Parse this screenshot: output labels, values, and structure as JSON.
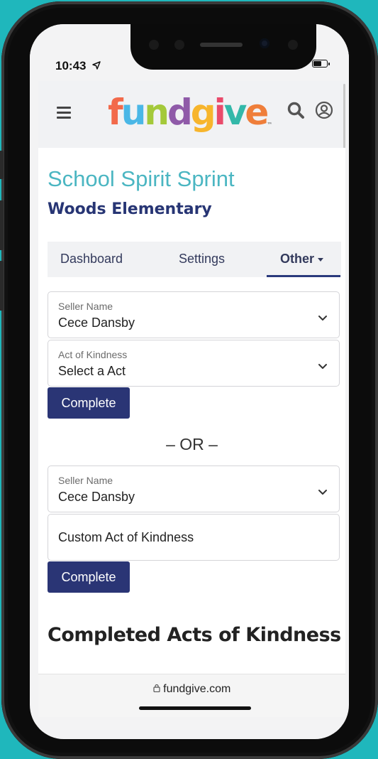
{
  "status_bar": {
    "time": "10:43"
  },
  "app_bar": {
    "logo_text": "fundgive",
    "logo_tm": "™"
  },
  "campaign": {
    "title": "School Spirit Sprint",
    "school": "Woods Elementary"
  },
  "tabs": [
    {
      "label": "Dashboard"
    },
    {
      "label": "Settings"
    },
    {
      "label": "Other",
      "active": true
    }
  ],
  "form1": {
    "seller_label": "Seller Name",
    "seller_value": "Cece Dansby",
    "act_label": "Act of Kindness",
    "act_value": "Select a Act",
    "button": "Complete"
  },
  "separator": "– OR –",
  "form2": {
    "seller_label": "Seller Name",
    "seller_value": "Cece Dansby",
    "custom_placeholder": "Custom Act of Kindness",
    "button": "Complete"
  },
  "section_heading": "Completed Acts of Kindness",
  "browser": {
    "url": "fundgive.com"
  },
  "colors": {
    "accent_teal": "#4bb6c2",
    "navy": "#273574",
    "button": "#2a3575",
    "background": "#1fb7bc"
  },
  "logo_letter_colors": [
    "#f26a4b",
    "#4ab7e6",
    "#a4c93a",
    "#8f5aa8",
    "#f7b52c",
    "#e94b6b",
    "#33b8a9",
    "#ef7e3a"
  ]
}
